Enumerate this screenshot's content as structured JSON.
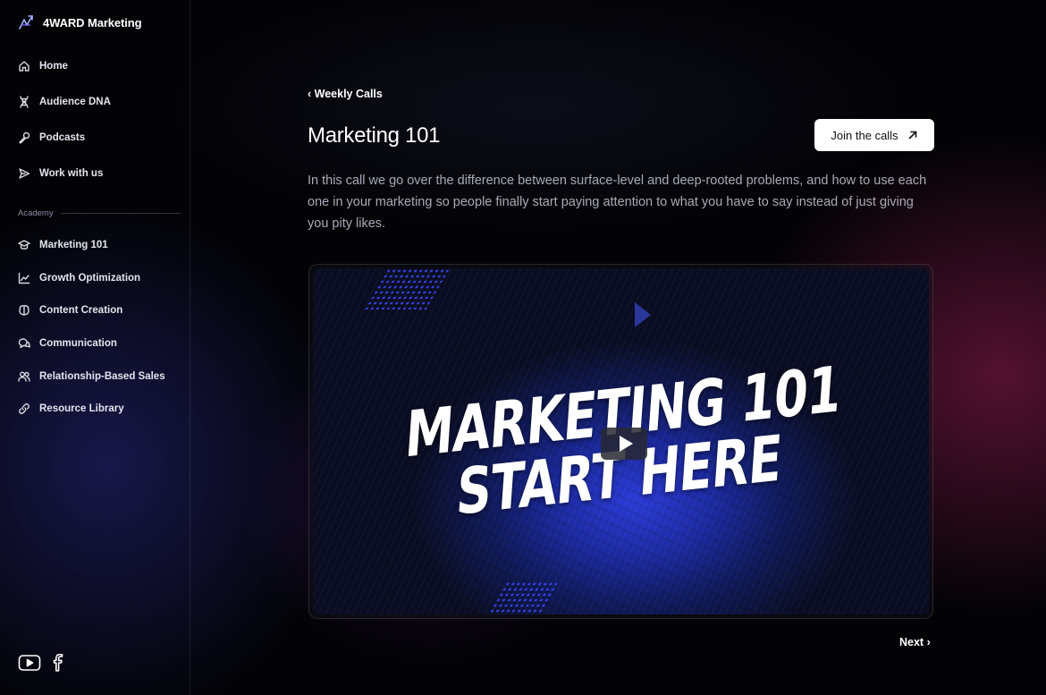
{
  "brand": {
    "name": "4WARD Marketing"
  },
  "sidebar": {
    "items": [
      {
        "label": "Home",
        "icon": "home-icon"
      },
      {
        "label": "Audience DNA",
        "icon": "dna-icon"
      },
      {
        "label": "Podcasts",
        "icon": "microphone-icon"
      },
      {
        "label": "Work with us",
        "icon": "send-icon"
      }
    ],
    "section_label": "Academy",
    "academy_items": [
      {
        "label": "Marketing 101",
        "icon": "graduation-cap-icon"
      },
      {
        "label": "Growth Optimization",
        "icon": "trend-chart-icon"
      },
      {
        "label": "Content Creation",
        "icon": "brain-icon"
      },
      {
        "label": "Communication",
        "icon": "chat-bubbles-icon"
      },
      {
        "label": "Relationship-Based Sales",
        "icon": "users-icon"
      },
      {
        "label": "Resource Library",
        "icon": "link-icon"
      }
    ],
    "social": [
      {
        "icon": "youtube-icon"
      },
      {
        "icon": "facebook-icon"
      }
    ]
  },
  "main": {
    "breadcrumb": "‹ Weekly Calls",
    "title": "Marketing 101",
    "join_button": "Join the calls",
    "description": "In this call we go over the difference between surface-level and deep-rooted problems, and how to use each one in your marketing so people finally start paying attention to what you have to say instead of just giving you pity likes.",
    "video": {
      "line1": "MARKETING 101",
      "line2": "START HERE"
    },
    "next_link": "Next ›"
  },
  "colors": {
    "background": "#030306",
    "text": "#ffffff",
    "muted_text": "#a9a9b6",
    "button_bg": "#ffffff",
    "video_accent": "#2b3bd6",
    "glow_pink": "#961e50"
  }
}
